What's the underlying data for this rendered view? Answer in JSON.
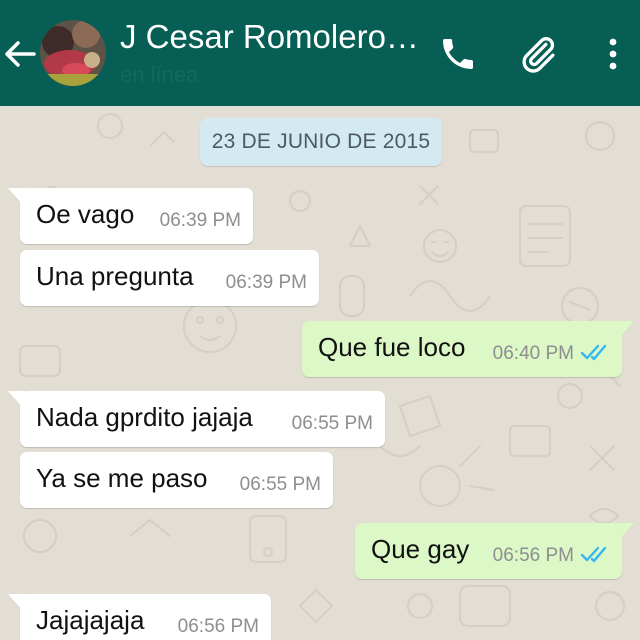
{
  "header": {
    "title": "J Cesar Romolero…",
    "status": "en línea",
    "icons": {
      "back": "arrow-left-icon",
      "call": "phone-icon",
      "attach": "paperclip-icon",
      "menu": "more-vert-icon"
    },
    "color": "#075e54"
  },
  "chat": {
    "date": "23 DE JUNIO DE 2015",
    "messages": [
      {
        "direction": "in",
        "text": "Oe vago",
        "time": "06:39 PM"
      },
      {
        "direction": "in",
        "text": "Una pregunta",
        "time": "06:39 PM"
      },
      {
        "direction": "out",
        "text": "Que fue loco",
        "time": "06:40 PM",
        "status": "read"
      },
      {
        "direction": "in",
        "text": "Nada gprdito jajaja",
        "time": "06:55 PM"
      },
      {
        "direction": "in",
        "text": "Ya se me paso",
        "time": "06:55 PM"
      },
      {
        "direction": "out",
        "text": "Que gay",
        "time": "06:56 PM",
        "status": "read"
      },
      {
        "direction": "in",
        "text": "Jajajajaja",
        "time": "06:56 PM"
      }
    ],
    "colors": {
      "incoming": "#ffffff",
      "outgoing": "#dcf8c6",
      "read_ticks": "#34b7f1",
      "wallpaper": "#e3ded4"
    }
  }
}
